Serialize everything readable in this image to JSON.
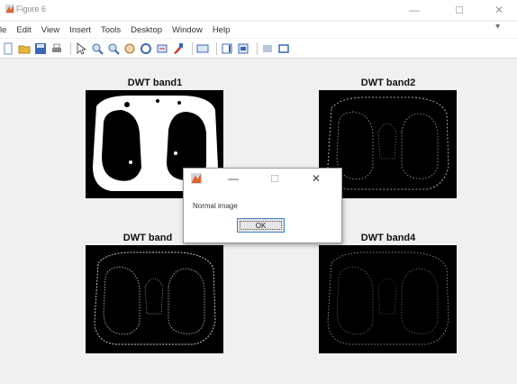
{
  "window": {
    "title": "Figure 6",
    "controls": {
      "minimize": "—",
      "maximize": "☐",
      "close": "✕"
    }
  },
  "menu": {
    "items": [
      "le",
      "Edit",
      "View",
      "Insert",
      "Tools",
      "Desktop",
      "Window",
      "Help"
    ],
    "overflow": "▾"
  },
  "toolbar": {
    "icons": [
      "new-figure-icon",
      "open-file-icon",
      "save-icon",
      "print-icon",
      "pointer-icon",
      "zoom-in-icon",
      "zoom-out-icon",
      "pan-icon",
      "rotate-3d-icon",
      "data-cursor-icon",
      "brush-icon",
      "link-plot-icon",
      "colorbar-icon",
      "legend-icon",
      "hide-plot-tools-icon",
      "show-plot-tools-icon"
    ]
  },
  "plots": {
    "band1": {
      "title": "DWT band1"
    },
    "band2": {
      "title": "DWT band2"
    },
    "band3": {
      "title": "DWT band"
    },
    "band4": {
      "title": "DWT band4"
    }
  },
  "dialog": {
    "message": "Normal image",
    "ok_label": "OK",
    "controls": {
      "minimize": "—",
      "maximize": "☐",
      "close": "✕"
    }
  },
  "colors": {
    "accent": "#3c7fd1",
    "axes_background": "#000000",
    "figure_background": "#f0f0f0"
  }
}
